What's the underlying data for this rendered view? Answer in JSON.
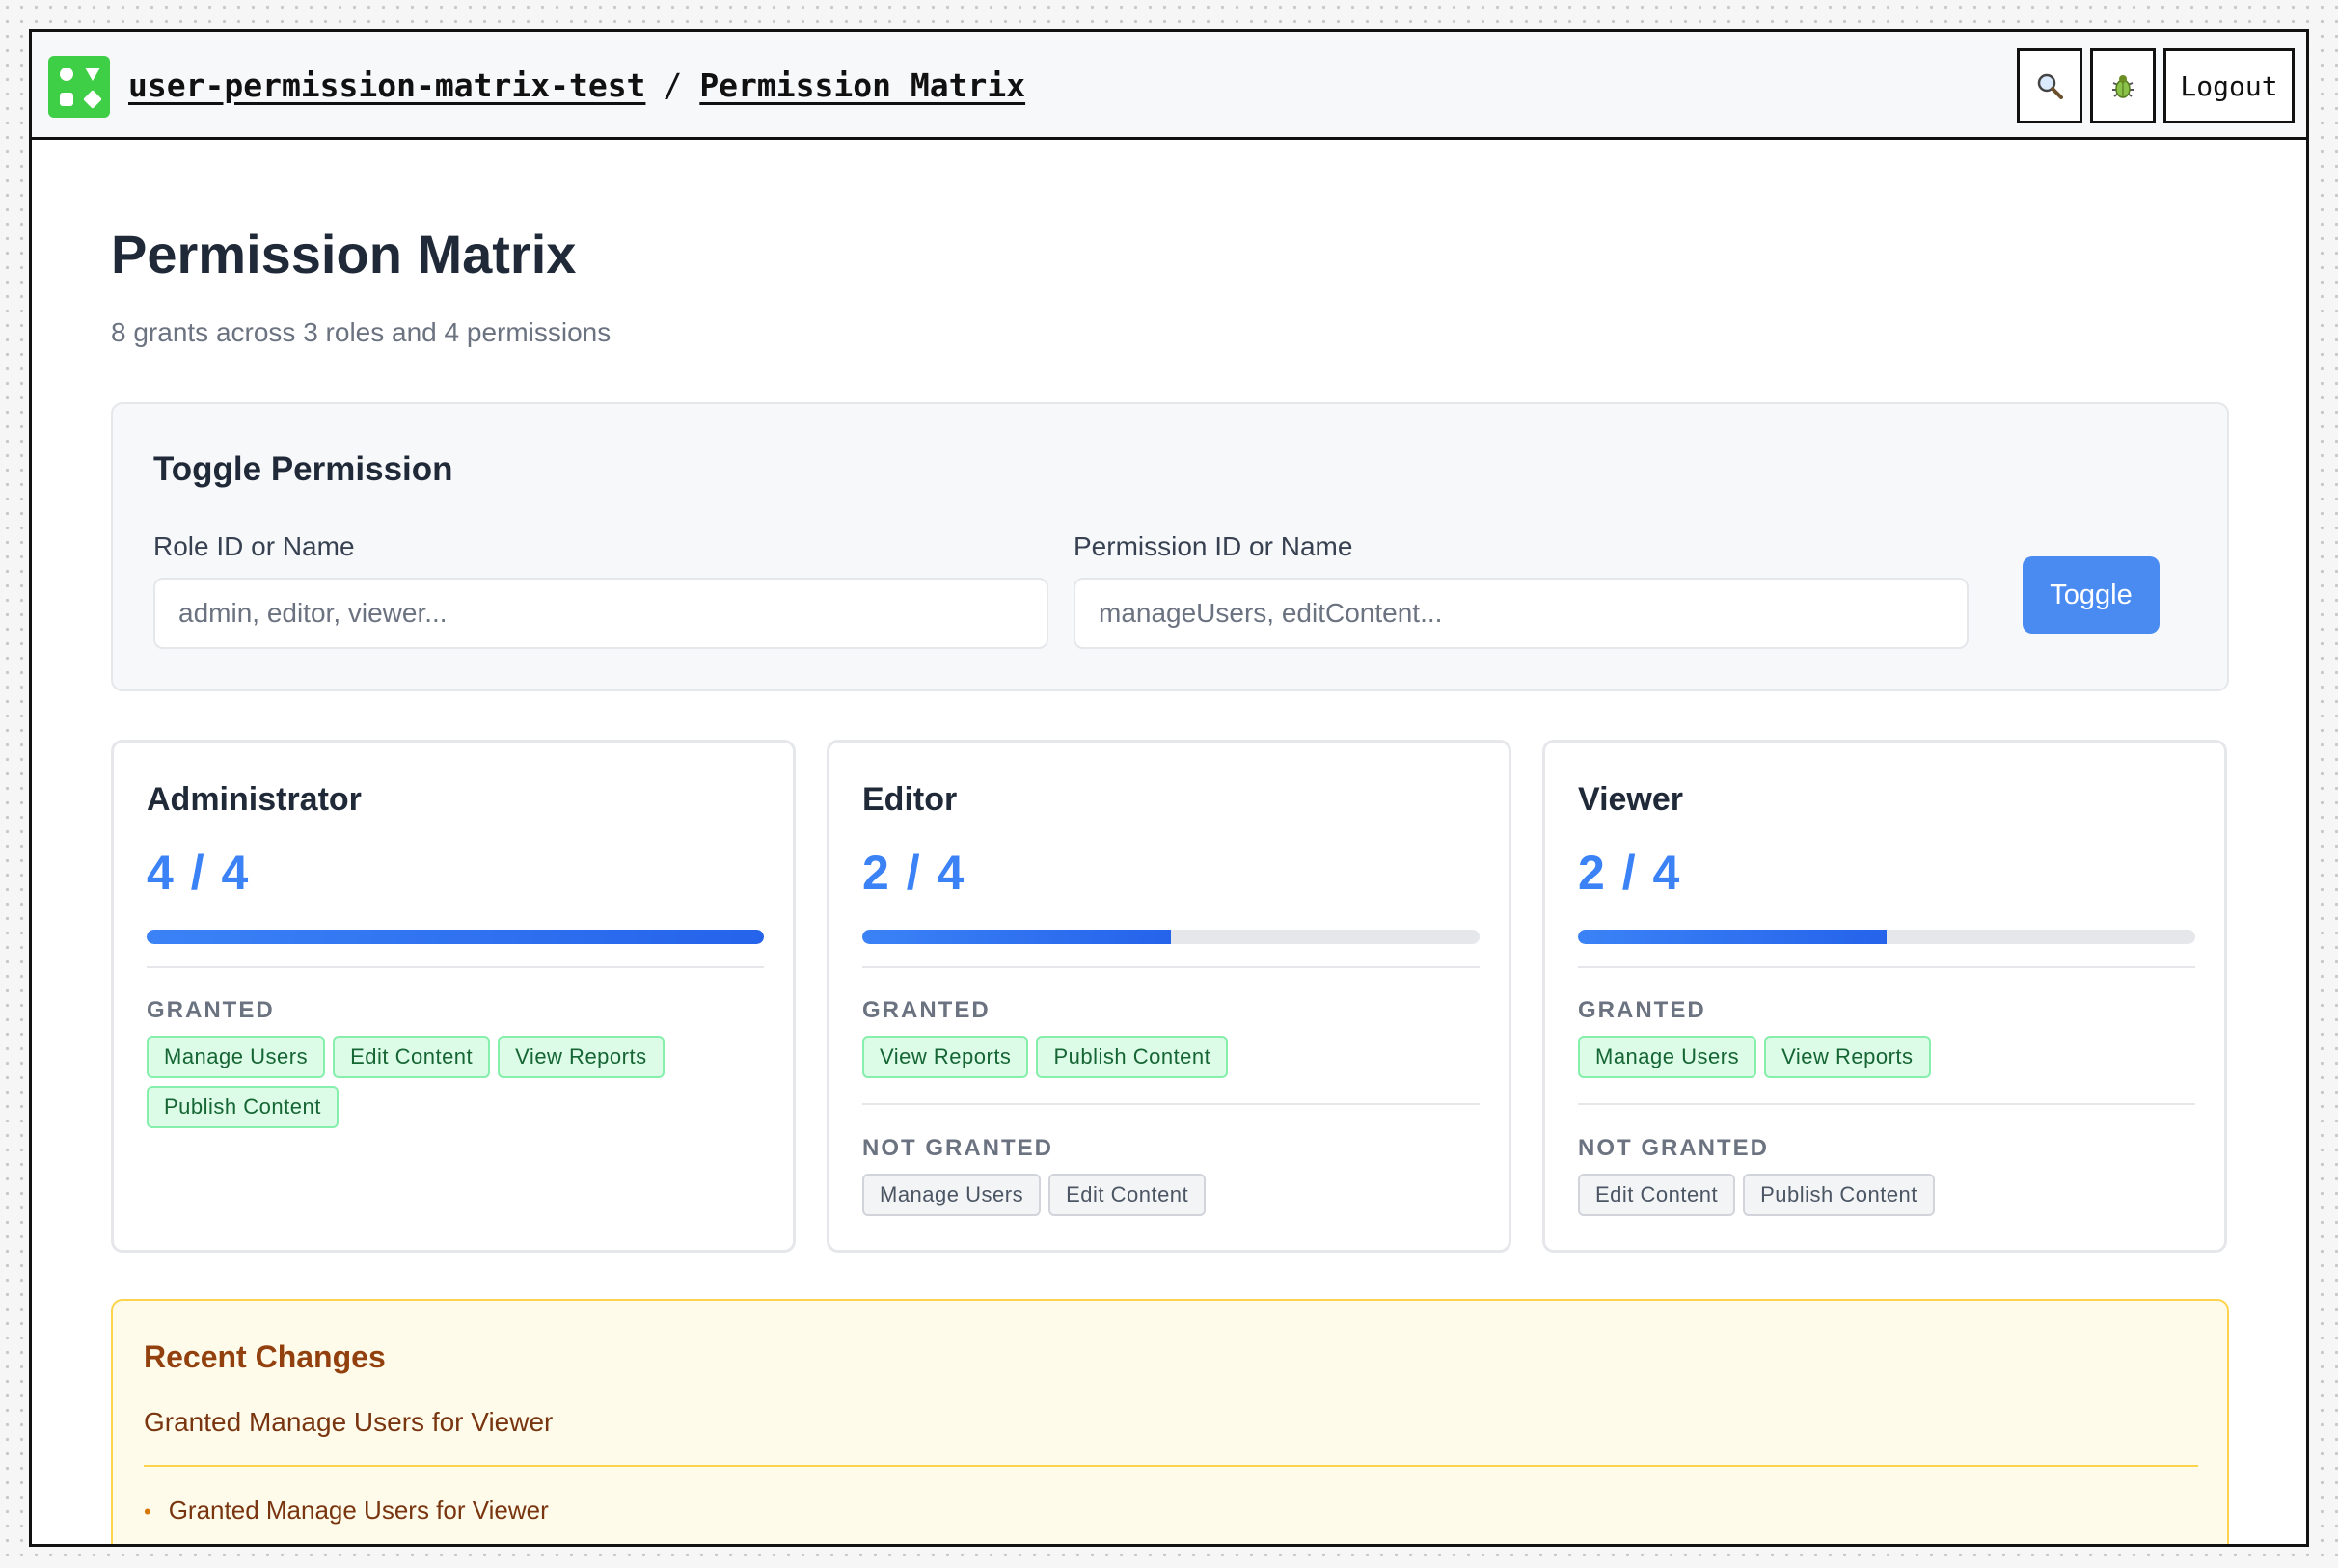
{
  "header": {
    "project": "user-permission-matrix-test",
    "separator": "/",
    "page": "Permission Matrix",
    "logout_label": "Logout"
  },
  "page": {
    "title": "Permission Matrix",
    "subtitle": "8 grants across 3 roles and 4 permissions"
  },
  "toggle": {
    "heading": "Toggle Permission",
    "role_label": "Role ID or Name",
    "role_placeholder": "admin, editor, viewer...",
    "role_value": "",
    "permission_label": "Permission ID or Name",
    "permission_placeholder": "manageUsers, editContent...",
    "permission_value": "",
    "button_label": "Toggle"
  },
  "roles": [
    {
      "name": "Administrator",
      "count_text": "4 / 4",
      "granted_count": 4,
      "total": 4,
      "granted_heading": "GRANTED",
      "granted": [
        "Manage Users",
        "Edit Content",
        "View Reports",
        "Publish Content"
      ],
      "not_granted_heading": "",
      "not_granted": []
    },
    {
      "name": "Editor",
      "count_text": "2 / 4",
      "granted_count": 2,
      "total": 4,
      "granted_heading": "GRANTED",
      "granted": [
        "View Reports",
        "Publish Content"
      ],
      "not_granted_heading": "NOT GRANTED",
      "not_granted": [
        "Manage Users",
        "Edit Content"
      ]
    },
    {
      "name": "Viewer",
      "count_text": "2 / 4",
      "granted_count": 2,
      "total": 4,
      "granted_heading": "GRANTED",
      "granted": [
        "Manage Users",
        "View Reports"
      ],
      "not_granted_heading": "NOT GRANTED",
      "not_granted": [
        "Edit Content",
        "Publish Content"
      ]
    }
  ],
  "changes": {
    "heading": "Recent Changes",
    "latest": "Granted Manage Users for Viewer",
    "items": [
      "Granted Manage Users for Viewer"
    ]
  },
  "icons": {
    "logo": "app-logo-icon",
    "search": "search-icon",
    "bug": "bug-icon",
    "bullet": "bullet-icon"
  },
  "colors": {
    "brand": "#3ecf47",
    "accent": "#4a8bf2",
    "progress": "#3b82f6",
    "granted_bg": "#dcfce7",
    "granted_text": "#166534",
    "not_granted_bg": "#f3f4f6",
    "changes_bg": "#fffbeb",
    "changes_text": "#92400e"
  }
}
